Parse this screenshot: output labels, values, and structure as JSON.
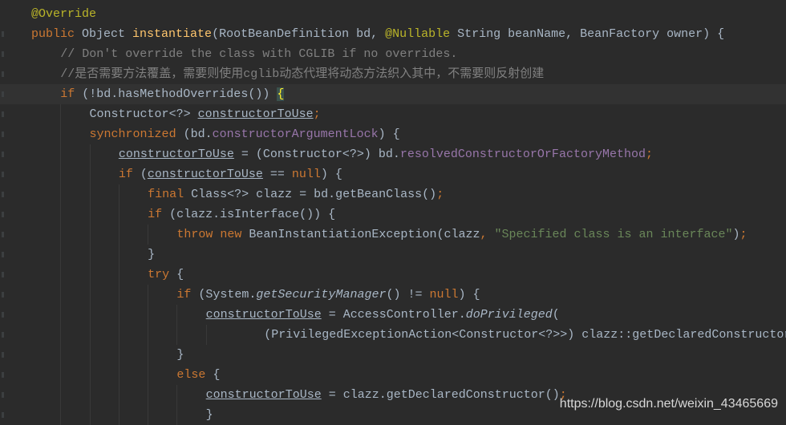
{
  "editor": {
    "current_line": 4,
    "lines": [
      {
        "indent": 0,
        "tokens": [
          [
            "@Override",
            "ann"
          ]
        ]
      },
      {
        "indent": 0,
        "tokens": [
          [
            "public ",
            "kw"
          ],
          [
            "Object ",
            ""
          ],
          [
            "instantiate",
            "decl"
          ],
          [
            "(RootBeanDefinition bd, ",
            ""
          ],
          [
            "@Nullable ",
            "ann"
          ],
          [
            "String beanName, BeanFactory owner) {",
            ""
          ]
        ]
      },
      {
        "indent": 1,
        "tokens": [
          [
            "// Don't override the class with CGLIB if no overrides.",
            "cm"
          ]
        ]
      },
      {
        "indent": 1,
        "tokens": [
          [
            "//是否需要方法覆盖，需要则使用cglib动态代理将动态方法织入其中，不需要则反射创建",
            "cm"
          ]
        ]
      },
      {
        "indent": 1,
        "tokens": [
          [
            "if ",
            "kw"
          ],
          [
            "(!bd.hasMethodOverrides()) ",
            ""
          ],
          [
            "{",
            "brace"
          ]
        ]
      },
      {
        "indent": 2,
        "tokens": [
          [
            "Constructor<?> ",
            ""
          ],
          [
            "constructorToUse",
            "ul"
          ],
          [
            ";",
            "kw"
          ]
        ]
      },
      {
        "indent": 2,
        "tokens": [
          [
            "synchronized ",
            "kw"
          ],
          [
            "(bd.",
            ""
          ],
          [
            "constructorArgumentLock",
            "fld"
          ],
          [
            ") {",
            ""
          ]
        ]
      },
      {
        "indent": 3,
        "tokens": [
          [
            "constructorToUse",
            "ul"
          ],
          [
            " = (Constructor<?>) bd.",
            ""
          ],
          [
            "resolvedConstructorOrFactoryMethod",
            "fld"
          ],
          [
            ";",
            "kw"
          ]
        ]
      },
      {
        "indent": 3,
        "tokens": [
          [
            "if ",
            "kw"
          ],
          [
            "(",
            ""
          ],
          [
            "constructorToUse",
            "ul"
          ],
          [
            " == ",
            ""
          ],
          [
            "null",
            "kw"
          ],
          [
            ") {",
            ""
          ]
        ]
      },
      {
        "indent": 4,
        "tokens": [
          [
            "final ",
            "kw"
          ],
          [
            "Class<?> clazz = bd.getBeanClass()",
            ""
          ],
          [
            ";",
            "kw"
          ]
        ]
      },
      {
        "indent": 4,
        "tokens": [
          [
            "if ",
            "kw"
          ],
          [
            "(clazz.isInterface()) {",
            ""
          ]
        ]
      },
      {
        "indent": 5,
        "tokens": [
          [
            "throw new ",
            "kw"
          ],
          [
            "BeanInstantiationException(clazz",
            ""
          ],
          [
            ", ",
            "kw"
          ],
          [
            "\"Specified class is an interface\"",
            "str"
          ],
          [
            ")",
            ""
          ],
          [
            ";",
            "kw"
          ]
        ]
      },
      {
        "indent": 4,
        "tokens": [
          [
            "}",
            ""
          ]
        ]
      },
      {
        "indent": 4,
        "tokens": [
          [
            "try ",
            "kw"
          ],
          [
            "{",
            ""
          ]
        ]
      },
      {
        "indent": 5,
        "tokens": [
          [
            "if ",
            "kw"
          ],
          [
            "(System.",
            ""
          ],
          [
            "getSecurityManager",
            "it"
          ],
          [
            "() != ",
            ""
          ],
          [
            "null",
            "kw"
          ],
          [
            ") {",
            ""
          ]
        ]
      },
      {
        "indent": 6,
        "tokens": [
          [
            "constructorToUse",
            "ul"
          ],
          [
            " = AccessController.",
            ""
          ],
          [
            "doPrivileged",
            "it"
          ],
          [
            "(",
            ""
          ]
        ]
      },
      {
        "indent": 8,
        "tokens": [
          [
            "(PrivilegedExceptionAction<Constructor<?>>) clazz::getDeclaredConstructor",
            ""
          ]
        ]
      },
      {
        "indent": 5,
        "tokens": [
          [
            "}",
            ""
          ]
        ]
      },
      {
        "indent": 5,
        "tokens": [
          [
            "else ",
            "kw"
          ],
          [
            "{",
            ""
          ]
        ]
      },
      {
        "indent": 6,
        "tokens": [
          [
            "constructorToUse",
            "ul"
          ],
          [
            " = clazz.getDeclaredConstructor()",
            ""
          ],
          [
            ";",
            "kw"
          ]
        ]
      },
      {
        "indent": 6,
        "tokens": [
          [
            "}",
            ""
          ]
        ]
      }
    ]
  },
  "watermark": "https://blog.csdn.net/weixin_43465669"
}
